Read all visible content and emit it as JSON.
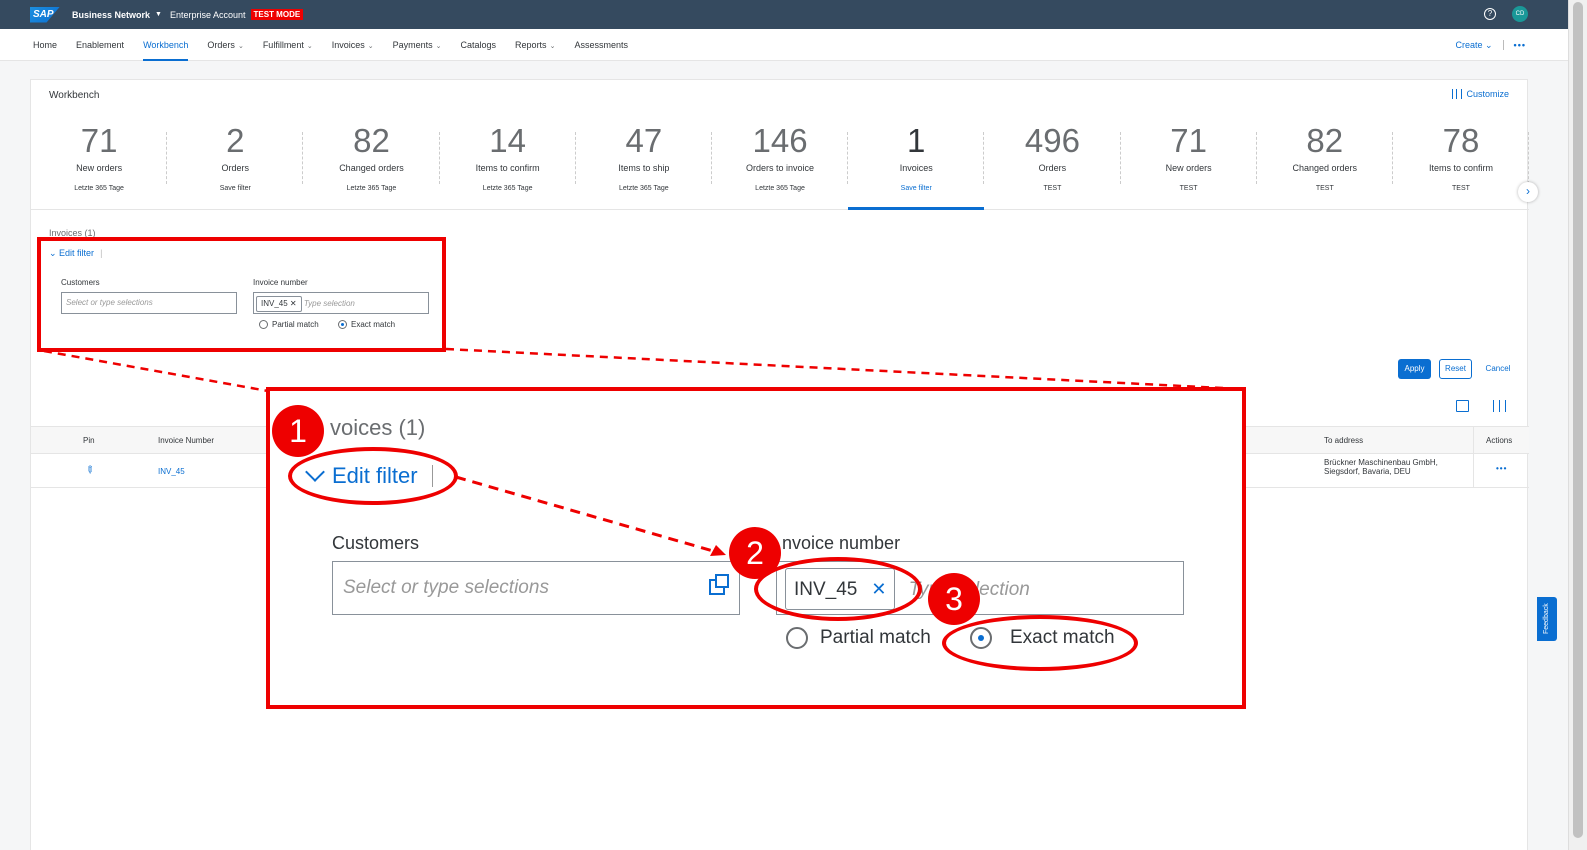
{
  "shell": {
    "logo": "SAP",
    "title": "Business Network",
    "account": "Enterprise Account",
    "test_mode": "TEST MODE",
    "avatar_initials": "CD"
  },
  "nav": {
    "items": [
      {
        "label": "Home"
      },
      {
        "label": "Enablement"
      },
      {
        "label": "Workbench"
      },
      {
        "label": "Orders"
      },
      {
        "label": "Fulfillment"
      },
      {
        "label": "Invoices"
      },
      {
        "label": "Payments"
      },
      {
        "label": "Catalogs"
      },
      {
        "label": "Reports"
      },
      {
        "label": "Assessments"
      }
    ],
    "create": "Create"
  },
  "workbench": {
    "title": "Workbench",
    "customize": "Customize",
    "tiles": [
      {
        "number": "71",
        "label": "New orders",
        "sub": "Letzte 365 Tage"
      },
      {
        "number": "2",
        "label": "Orders",
        "sub": "Save filter"
      },
      {
        "number": "82",
        "label": "Changed orders",
        "sub": "Letzte 365 Tage"
      },
      {
        "number": "14",
        "label": "Items to confirm",
        "sub": "Letzte 365 Tage"
      },
      {
        "number": "47",
        "label": "Items to ship",
        "sub": "Letzte 365 Tage"
      },
      {
        "number": "146",
        "label": "Orders to invoice",
        "sub": "Letzte 365 Tage"
      },
      {
        "number": "1",
        "label": "Invoices",
        "sub": "Save filter"
      },
      {
        "number": "496",
        "label": "Orders",
        "sub": "TEST"
      },
      {
        "number": "71",
        "label": "New orders",
        "sub": "TEST"
      },
      {
        "number": "82",
        "label": "Changed orders",
        "sub": "TEST"
      },
      {
        "number": "78",
        "label": "Items to confirm",
        "sub": "TEST"
      }
    ]
  },
  "filter": {
    "heading": "Invoices (1)",
    "edit_filter": "Edit filter",
    "customers_label": "Customers",
    "customers_placeholder": "Select or type selections",
    "invoice_label": "Invoice number",
    "invoice_token": "INV_45",
    "invoice_placeholder": "Type selection",
    "partial_match": "Partial match",
    "exact_match": "Exact match",
    "apply": "Apply",
    "reset": "Reset",
    "cancel": "Cancel"
  },
  "zoom": {
    "heading": "voices (1)",
    "invoice_label": "nvoice number",
    "invoice_placeholder": "Type selection"
  },
  "table": {
    "headers": [
      "Pin",
      "Invoice Number",
      "To address",
      "Actions"
    ],
    "row": {
      "invoice": "INV_45",
      "address": "Brückner Maschinenbau GmbH, Siegsdorf, Bavaria, DEU"
    }
  },
  "steps": [
    "1",
    "2",
    "3"
  ],
  "feedback": "Feedback",
  "colors": {
    "brand": "#0a6ed1",
    "shell": "#354a5f",
    "highlight": "#e00000"
  }
}
